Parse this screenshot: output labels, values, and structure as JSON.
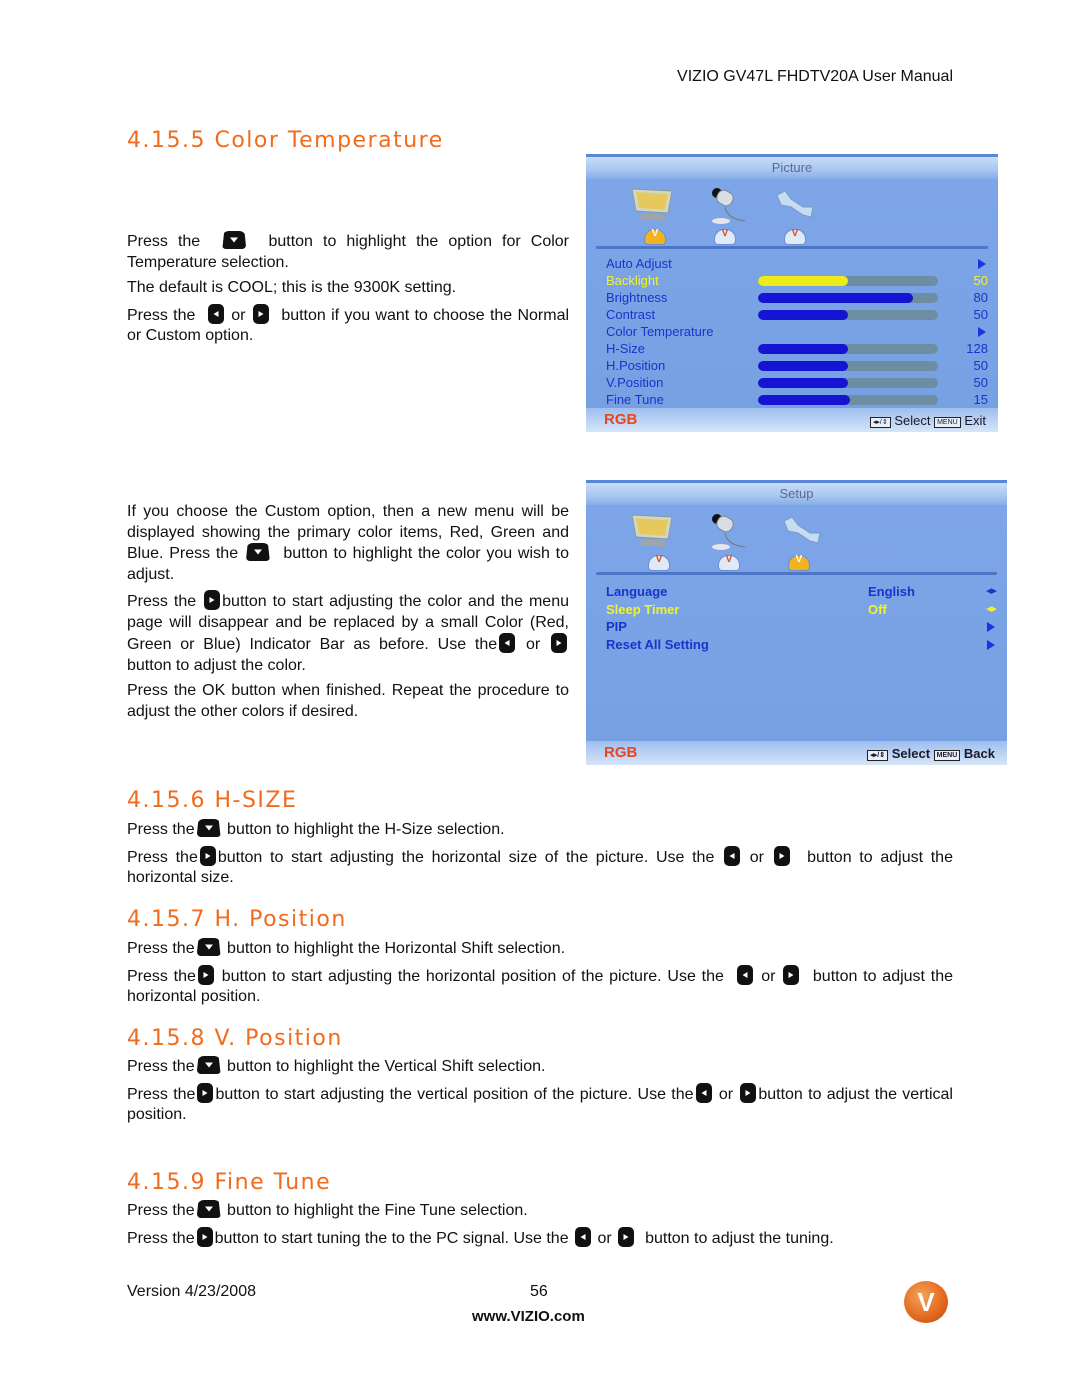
{
  "header": {
    "title": "VIZIO GV47L FHDTV20A User Manual"
  },
  "sections": {
    "color_temperature": {
      "heading": "4.15.5 Color Temperature",
      "p1_a": "Press the",
      "p1_b": "button to highlight the option for Color Temperature selection.",
      "p2": "The default is COOL; this is the 9300K setting.",
      "p3_a": "Press the",
      "p3_or": "or",
      "p3_b": "button if you want to choose the Normal or Custom option.",
      "p4_a": "If you choose the Custom option, then a new menu will be displayed showing the primary color items, Red, Green and Blue.  Press the",
      "p4_b": "button to highlight the color you wish to adjust.",
      "p5_a": "Press the",
      "p5_b": "button to start adjusting the color and the menu page will disappear and be replaced by a small Color (Red, Green or Blue) Indicator Bar as before.  Use the",
      "p5_or": "or",
      "p5_c": "button to adjust the color.",
      "p6": "Press the OK button when finished.  Repeat the procedure to adjust the other colors if desired."
    },
    "h_size": {
      "heading": "4.15.6 H-SIZE",
      "p1_a": "Press the",
      "p1_b": "button to highlight the H-Size selection.",
      "p2_a": "Press the",
      "p2_b": "button to start adjusting the horizontal size of the picture.  Use the",
      "p2_or": "or",
      "p2_c": "button to adjust the horizontal size."
    },
    "h_position": {
      "heading": "4.15.7 H. Position",
      "p1_a": "Press the",
      "p1_b": "button to highlight the Horizontal Shift selection.",
      "p2_a": "Press the",
      "p2_b": "button to start adjusting the horizontal position of the picture.  Use the",
      "p2_or": "or",
      "p2_c": "button to adjust the horizontal position."
    },
    "v_position": {
      "heading": "4.15.8 V. Position",
      "p1_a": "Press the",
      "p1_b": "button to highlight the Vertical Shift selection.",
      "p2_a": "Press the",
      "p2_b": "button to start adjusting the vertical position of the picture.  Use the",
      "p2_or": "or",
      "p2_c": "button to adjust the vertical position."
    },
    "fine_tune": {
      "heading": "4.15.9 Fine Tune",
      "p1_a": "Press the",
      "p1_b": "button to highlight the Fine Tune selection.",
      "p2_a": "Press the",
      "p2_b": "button to start tuning the to the PC signal.  Use the",
      "p2_or": "or",
      "p2_c": "button to adjust the tuning."
    }
  },
  "picture_menu": {
    "title": "Picture",
    "items": [
      {
        "label": "Auto  Adjust",
        "type": "arrow"
      },
      {
        "label": "Backlight",
        "value": "50",
        "fraction": 0.5,
        "highlighted": true
      },
      {
        "label": "Brightness",
        "value": "80",
        "fraction": 0.86
      },
      {
        "label": "Contrast",
        "value": "50",
        "fraction": 0.5
      },
      {
        "label": "Color  Temperature",
        "type": "arrow"
      },
      {
        "label": "H-Size",
        "value": "128",
        "fraction": 0.5
      },
      {
        "label": "H.Position",
        "value": "50",
        "fraction": 0.5
      },
      {
        "label": "V.Position",
        "value": "50",
        "fraction": 0.5
      },
      {
        "label": "Fine  Tune",
        "value": "15",
        "fraction": 0.51
      }
    ],
    "source": "RGB",
    "hint_select": "Select",
    "hint_menu_key": "MENU",
    "hint_exit": "Exit"
  },
  "setup_menu": {
    "title": "Setup",
    "items": [
      {
        "label": "Language",
        "value": "English",
        "type": "leftright"
      },
      {
        "label": "Sleep Timer",
        "value": "Off",
        "type": "leftright",
        "highlighted": true
      },
      {
        "label": "PIP",
        "type": "arrow"
      },
      {
        "label": "Reset All Setting",
        "type": "arrow"
      }
    ],
    "source": "RGB",
    "hint_select": "Select",
    "hint_menu_key": "MENU",
    "hint_back": "Back"
  },
  "colors": {
    "heading": "#f26a1b",
    "osd_blue": "#1b33c9",
    "osd_highlight": "#f2f22a",
    "rgb_label": "#e8461c"
  },
  "footer": {
    "version": "Version 4/23/2008",
    "page": "56",
    "website": "www.VIZIO.com",
    "logo_letter": "V"
  }
}
